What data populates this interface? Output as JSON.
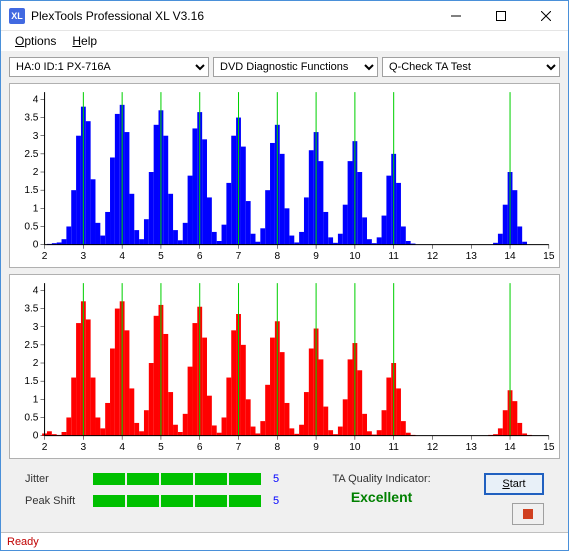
{
  "titlebar": {
    "icon_text": "XL",
    "title": "PlexTools Professional XL V3.16"
  },
  "menubar": {
    "options": "Options",
    "help": "Help"
  },
  "dropdowns": {
    "drive_label": "HA:0 ID:1  PX-716A",
    "function_label": "DVD Diagnostic Functions",
    "test_label": "Q-Check TA Test"
  },
  "chart_data": [
    {
      "type": "bar",
      "color": "#0000ff",
      "xticks": [
        2,
        3,
        4,
        5,
        6,
        7,
        8,
        9,
        10,
        11,
        12,
        13,
        14,
        15
      ],
      "yticks": [
        0,
        0.5,
        1,
        1.5,
        2,
        2.5,
        3,
        3.5,
        4
      ],
      "ylim": [
        0,
        4.2
      ],
      "gridlines_x": [
        3,
        4,
        5,
        6,
        7,
        8,
        9,
        10,
        11,
        14
      ],
      "bins_per_unit": 8,
      "series": [
        {
          "x": 2.125,
          "h": 0.02
        },
        {
          "x": 2.25,
          "h": 0.04
        },
        {
          "x": 2.375,
          "h": 0.06
        },
        {
          "x": 2.5,
          "h": 0.15
        },
        {
          "x": 2.625,
          "h": 0.5
        },
        {
          "x": 2.75,
          "h": 1.5
        },
        {
          "x": 2.875,
          "h": 3.0
        },
        {
          "x": 3.0,
          "h": 3.8
        },
        {
          "x": 3.125,
          "h": 3.4
        },
        {
          "x": 3.25,
          "h": 1.8
        },
        {
          "x": 3.375,
          "h": 0.6
        },
        {
          "x": 3.5,
          "h": 0.25
        },
        {
          "x": 3.625,
          "h": 0.9
        },
        {
          "x": 3.75,
          "h": 2.4
        },
        {
          "x": 3.875,
          "h": 3.6
        },
        {
          "x": 4.0,
          "h": 3.85
        },
        {
          "x": 4.125,
          "h": 3.1
        },
        {
          "x": 4.25,
          "h": 1.4
        },
        {
          "x": 4.375,
          "h": 0.4
        },
        {
          "x": 4.5,
          "h": 0.15
        },
        {
          "x": 4.625,
          "h": 0.7
        },
        {
          "x": 4.75,
          "h": 2.0
        },
        {
          "x": 4.875,
          "h": 3.3
        },
        {
          "x": 5.0,
          "h": 3.7
        },
        {
          "x": 5.125,
          "h": 3.0
        },
        {
          "x": 5.25,
          "h": 1.4
        },
        {
          "x": 5.375,
          "h": 0.4
        },
        {
          "x": 5.5,
          "h": 0.12
        },
        {
          "x": 5.625,
          "h": 0.6
        },
        {
          "x": 5.75,
          "h": 1.9
        },
        {
          "x": 5.875,
          "h": 3.2
        },
        {
          "x": 6.0,
          "h": 3.65
        },
        {
          "x": 6.125,
          "h": 2.9
        },
        {
          "x": 6.25,
          "h": 1.3
        },
        {
          "x": 6.375,
          "h": 0.35
        },
        {
          "x": 6.5,
          "h": 0.1
        },
        {
          "x": 6.625,
          "h": 0.55
        },
        {
          "x": 6.75,
          "h": 1.7
        },
        {
          "x": 6.875,
          "h": 3.0
        },
        {
          "x": 7.0,
          "h": 3.5
        },
        {
          "x": 7.125,
          "h": 2.7
        },
        {
          "x": 7.25,
          "h": 1.2
        },
        {
          "x": 7.375,
          "h": 0.3
        },
        {
          "x": 7.5,
          "h": 0.08
        },
        {
          "x": 7.625,
          "h": 0.45
        },
        {
          "x": 7.75,
          "h": 1.5
        },
        {
          "x": 7.875,
          "h": 2.8
        },
        {
          "x": 8.0,
          "h": 3.3
        },
        {
          "x": 8.125,
          "h": 2.5
        },
        {
          "x": 8.25,
          "h": 1.0
        },
        {
          "x": 8.375,
          "h": 0.25
        },
        {
          "x": 8.5,
          "h": 0.06
        },
        {
          "x": 8.625,
          "h": 0.35
        },
        {
          "x": 8.75,
          "h": 1.3
        },
        {
          "x": 8.875,
          "h": 2.6
        },
        {
          "x": 9.0,
          "h": 3.1
        },
        {
          "x": 9.125,
          "h": 2.3
        },
        {
          "x": 9.25,
          "h": 0.9
        },
        {
          "x": 9.375,
          "h": 0.2
        },
        {
          "x": 9.5,
          "h": 0.05
        },
        {
          "x": 9.625,
          "h": 0.3
        },
        {
          "x": 9.75,
          "h": 1.1
        },
        {
          "x": 9.875,
          "h": 2.3
        },
        {
          "x": 10.0,
          "h": 2.85
        },
        {
          "x": 10.125,
          "h": 2.0
        },
        {
          "x": 10.25,
          "h": 0.75
        },
        {
          "x": 10.375,
          "h": 0.15
        },
        {
          "x": 10.5,
          "h": 0.04
        },
        {
          "x": 10.625,
          "h": 0.2
        },
        {
          "x": 10.75,
          "h": 0.8
        },
        {
          "x": 10.875,
          "h": 1.9
        },
        {
          "x": 11.0,
          "h": 2.5
        },
        {
          "x": 11.125,
          "h": 1.7
        },
        {
          "x": 11.25,
          "h": 0.5
        },
        {
          "x": 11.375,
          "h": 0.1
        },
        {
          "x": 11.5,
          "h": 0.03
        },
        {
          "x": 13.625,
          "h": 0.05
        },
        {
          "x": 13.75,
          "h": 0.3
        },
        {
          "x": 13.875,
          "h": 1.1
        },
        {
          "x": 14.0,
          "h": 2.0
        },
        {
          "x": 14.125,
          "h": 1.5
        },
        {
          "x": 14.25,
          "h": 0.5
        },
        {
          "x": 14.375,
          "h": 0.08
        }
      ]
    },
    {
      "type": "bar",
      "color": "#ff0000",
      "xticks": [
        2,
        3,
        4,
        5,
        6,
        7,
        8,
        9,
        10,
        11,
        12,
        13,
        14,
        15
      ],
      "yticks": [
        0,
        0.5,
        1,
        1.5,
        2,
        2.5,
        3,
        3.5,
        4
      ],
      "ylim": [
        0,
        4.2
      ],
      "gridlines_x": [
        3,
        4,
        5,
        6,
        7,
        8,
        9,
        10,
        11,
        14
      ],
      "bins_per_unit": 8,
      "series": [
        {
          "x": 2.0,
          "h": 0.06
        },
        {
          "x": 2.125,
          "h": 0.12
        },
        {
          "x": 2.25,
          "h": 0.04
        },
        {
          "x": 2.375,
          "h": 0.02
        },
        {
          "x": 2.5,
          "h": 0.1
        },
        {
          "x": 2.625,
          "h": 0.5
        },
        {
          "x": 2.75,
          "h": 1.6
        },
        {
          "x": 2.875,
          "h": 3.1
        },
        {
          "x": 3.0,
          "h": 3.7
        },
        {
          "x": 3.125,
          "h": 3.2
        },
        {
          "x": 3.25,
          "h": 1.6
        },
        {
          "x": 3.375,
          "h": 0.5
        },
        {
          "x": 3.5,
          "h": 0.2
        },
        {
          "x": 3.625,
          "h": 0.9
        },
        {
          "x": 3.75,
          "h": 2.4
        },
        {
          "x": 3.875,
          "h": 3.5
        },
        {
          "x": 4.0,
          "h": 3.7
        },
        {
          "x": 4.125,
          "h": 2.9
        },
        {
          "x": 4.25,
          "h": 1.3
        },
        {
          "x": 4.375,
          "h": 0.35
        },
        {
          "x": 4.5,
          "h": 0.12
        },
        {
          "x": 4.625,
          "h": 0.7
        },
        {
          "x": 4.75,
          "h": 2.0
        },
        {
          "x": 4.875,
          "h": 3.3
        },
        {
          "x": 5.0,
          "h": 3.6
        },
        {
          "x": 5.125,
          "h": 2.8
        },
        {
          "x": 5.25,
          "h": 1.2
        },
        {
          "x": 5.375,
          "h": 0.3
        },
        {
          "x": 5.5,
          "h": 0.1
        },
        {
          "x": 5.625,
          "h": 0.6
        },
        {
          "x": 5.75,
          "h": 1.9
        },
        {
          "x": 5.875,
          "h": 3.1
        },
        {
          "x": 6.0,
          "h": 3.55
        },
        {
          "x": 6.125,
          "h": 2.7
        },
        {
          "x": 6.25,
          "h": 1.1
        },
        {
          "x": 6.375,
          "h": 0.28
        },
        {
          "x": 6.5,
          "h": 0.08
        },
        {
          "x": 6.625,
          "h": 0.5
        },
        {
          "x": 6.75,
          "h": 1.6
        },
        {
          "x": 6.875,
          "h": 2.9
        },
        {
          "x": 7.0,
          "h": 3.35
        },
        {
          "x": 7.125,
          "h": 2.5
        },
        {
          "x": 7.25,
          "h": 1.0
        },
        {
          "x": 7.375,
          "h": 0.25
        },
        {
          "x": 7.5,
          "h": 0.06
        },
        {
          "x": 7.625,
          "h": 0.4
        },
        {
          "x": 7.75,
          "h": 1.4
        },
        {
          "x": 7.875,
          "h": 2.7
        },
        {
          "x": 8.0,
          "h": 3.15
        },
        {
          "x": 8.125,
          "h": 2.3
        },
        {
          "x": 8.25,
          "h": 0.9
        },
        {
          "x": 8.375,
          "h": 0.2
        },
        {
          "x": 8.5,
          "h": 0.05
        },
        {
          "x": 8.625,
          "h": 0.3
        },
        {
          "x": 8.75,
          "h": 1.2
        },
        {
          "x": 8.875,
          "h": 2.4
        },
        {
          "x": 9.0,
          "h": 2.95
        },
        {
          "x": 9.125,
          "h": 2.1
        },
        {
          "x": 9.25,
          "h": 0.8
        },
        {
          "x": 9.375,
          "h": 0.15
        },
        {
          "x": 9.5,
          "h": 0.04
        },
        {
          "x": 9.625,
          "h": 0.25
        },
        {
          "x": 9.75,
          "h": 1.0
        },
        {
          "x": 9.875,
          "h": 2.1
        },
        {
          "x": 10.0,
          "h": 2.55
        },
        {
          "x": 10.125,
          "h": 1.8
        },
        {
          "x": 10.25,
          "h": 0.6
        },
        {
          "x": 10.375,
          "h": 0.12
        },
        {
          "x": 10.5,
          "h": 0.03
        },
        {
          "x": 10.625,
          "h": 0.15
        },
        {
          "x": 10.75,
          "h": 0.7
        },
        {
          "x": 10.875,
          "h": 1.6
        },
        {
          "x": 11.0,
          "h": 2.0
        },
        {
          "x": 11.125,
          "h": 1.3
        },
        {
          "x": 11.25,
          "h": 0.4
        },
        {
          "x": 11.375,
          "h": 0.08
        },
        {
          "x": 11.5,
          "h": 0.02
        },
        {
          "x": 13.5,
          "h": 0.02
        },
        {
          "x": 13.625,
          "h": 0.04
        },
        {
          "x": 13.75,
          "h": 0.2
        },
        {
          "x": 13.875,
          "h": 0.7
        },
        {
          "x": 14.0,
          "h": 1.25
        },
        {
          "x": 14.125,
          "h": 0.95
        },
        {
          "x": 14.25,
          "h": 0.35
        },
        {
          "x": 14.375,
          "h": 0.06
        },
        {
          "x": 14.5,
          "h": 0.02
        }
      ]
    }
  ],
  "metrics": {
    "jitter_label": "Jitter",
    "jitter_value": "5",
    "jitter_segments": 5,
    "peakshift_label": "Peak Shift",
    "peakshift_value": "5",
    "peakshift_segments": 5
  },
  "quality": {
    "label": "TA Quality Indicator:",
    "value": "Excellent"
  },
  "buttons": {
    "start": "Start"
  },
  "status": {
    "text": "Ready"
  }
}
